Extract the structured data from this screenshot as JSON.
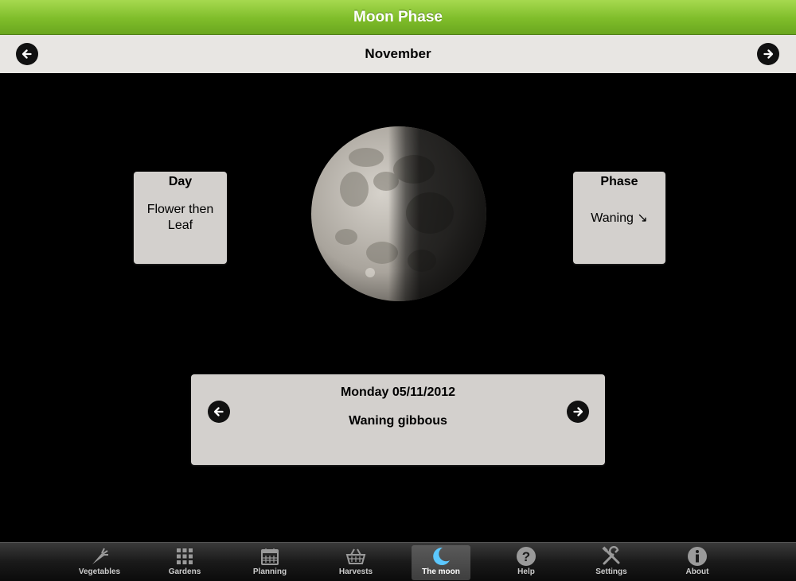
{
  "app": {
    "title": "Moon Phase"
  },
  "nav": {
    "month": "November"
  },
  "day_card": {
    "header": "Day",
    "value": "Flower then Leaf"
  },
  "phase_card": {
    "header": "Phase",
    "value": "Waning ↘"
  },
  "date_panel": {
    "date": "Monday 05/11/2012",
    "phase_name": "Waning gibbous"
  },
  "tabs": [
    {
      "label": "Vegetables",
      "icon": "carrot-icon"
    },
    {
      "label": "Gardens",
      "icon": "grid-icon"
    },
    {
      "label": "Planning",
      "icon": "calendar-icon"
    },
    {
      "label": "Harvests",
      "icon": "basket-icon"
    },
    {
      "label": "The moon",
      "icon": "moon-icon",
      "active": true
    },
    {
      "label": "Help",
      "icon": "help-icon"
    },
    {
      "label": "Settings",
      "icon": "settings-icon"
    },
    {
      "label": "About",
      "icon": "info-icon"
    }
  ],
  "colors": {
    "title_bar": "#8cc63f",
    "card_bg": "#d3d0cd",
    "active_tab_icon": "#5cc8ff"
  }
}
